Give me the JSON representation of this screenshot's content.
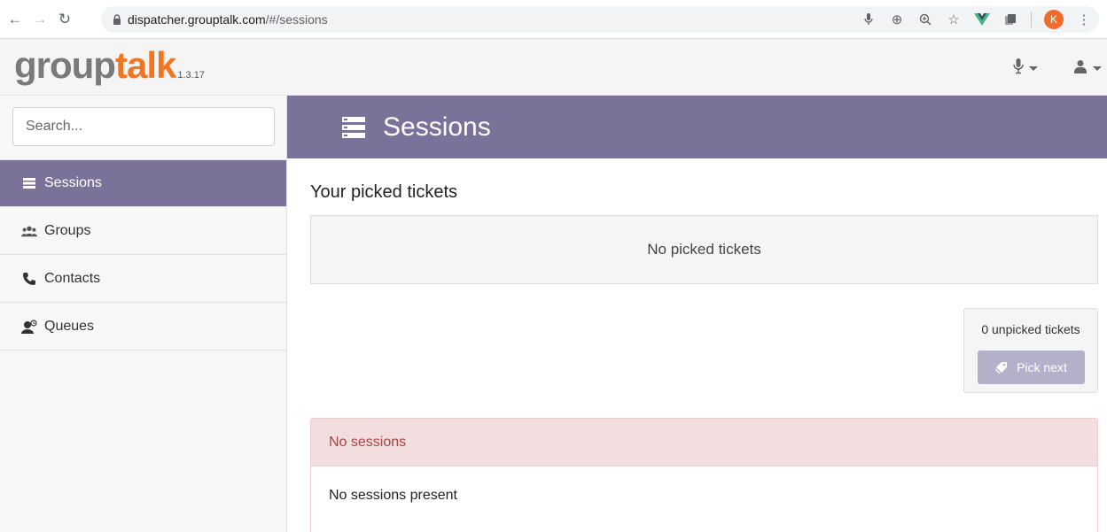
{
  "browser": {
    "url_host": "dispatcher.grouptalk.com",
    "url_path": "/#/sessions",
    "profile_initial": "K"
  },
  "app": {
    "logo_part1": "group",
    "logo_part2": "talk",
    "version": "1.3.17"
  },
  "sidebar": {
    "search_placeholder": "Search...",
    "items": [
      {
        "label": "Sessions",
        "icon": "list-icon",
        "active": true
      },
      {
        "label": "Groups",
        "icon": "group-icon",
        "active": false
      },
      {
        "label": "Contacts",
        "icon": "phone-icon",
        "active": false
      },
      {
        "label": "Queues",
        "icon": "queue-icon",
        "active": false
      }
    ]
  },
  "main": {
    "page_title": "Sessions",
    "picked_title": "Your picked tickets",
    "picked_empty": "No picked tickets",
    "unpicked_count": "0 unpicked tickets",
    "pick_next_label": "Pick next",
    "alert_title": "No sessions",
    "alert_body": "No sessions present"
  },
  "colors": {
    "accent": "#7a7298",
    "logo_orange": "#f0761f",
    "alert_bg": "#f2dede",
    "alert_text": "#a94442"
  }
}
